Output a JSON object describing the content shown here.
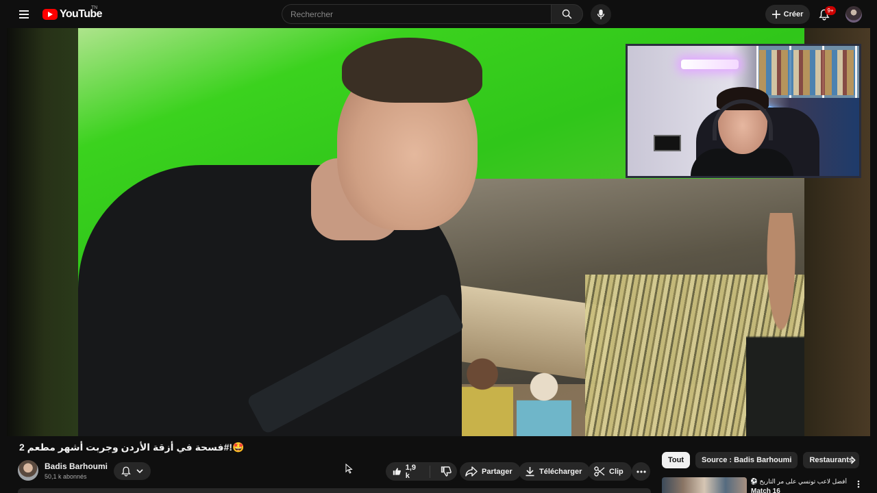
{
  "header": {
    "logo_text": "YouTube",
    "logo_country": "TN",
    "search_placeholder": "Rechercher",
    "create_label": "Créer",
    "notif_count": "9+"
  },
  "video": {
    "title": "فسحة في أزقة الأردن وجربت أشهر مطعم 2#!🤩"
  },
  "channel": {
    "name": "Badis Barhoumi",
    "subscribers": "50,1 k abonnés"
  },
  "actions": {
    "like_count": "1,9 k",
    "share_label": "Partager",
    "download_label": "Télécharger",
    "clip_label": "Clip"
  },
  "chips": [
    "Tout",
    "Source : Badis Barhoumi",
    "Restaurants"
  ],
  "recommendation": {
    "title": "أفضل لاعب تونسي على مر التاريخ ⚽",
    "subtitle": "Match 16"
  }
}
